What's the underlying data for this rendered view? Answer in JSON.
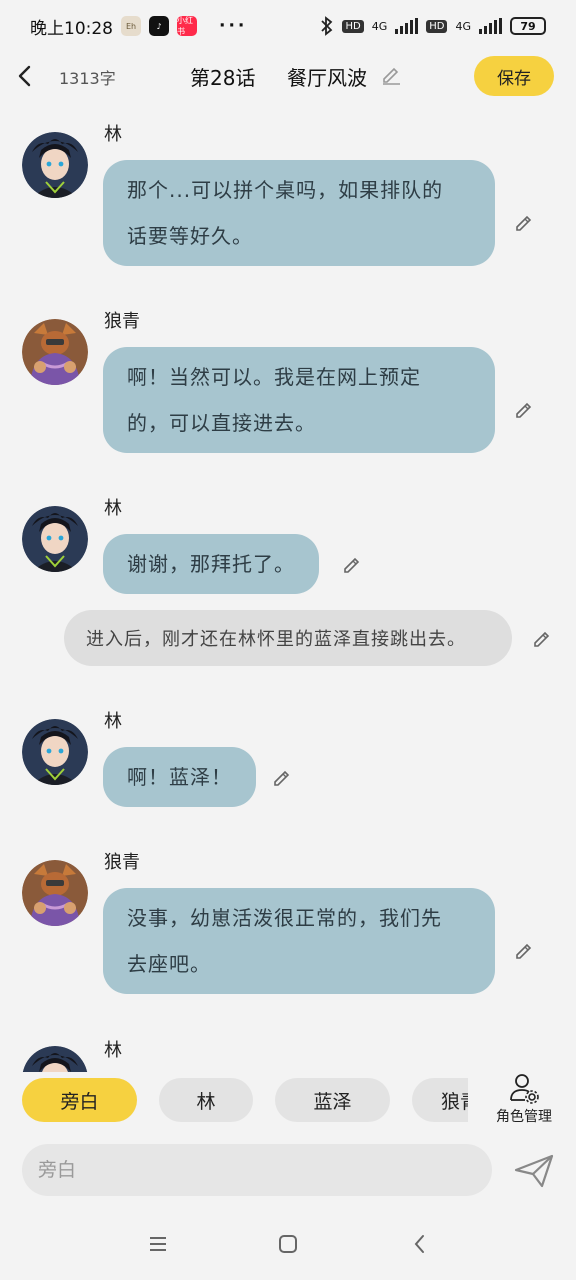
{
  "status_bar": {
    "time": "晚上10:28",
    "apps": [
      "Eh",
      "抖音",
      "小红书"
    ],
    "more": "···",
    "hd1": "HD",
    "net1": "4G",
    "hd2": "HD",
    "net2": "4G",
    "battery": "79"
  },
  "header": {
    "word_count": "1313字",
    "chapter": "第28话",
    "chapter_name": "餐厅风波",
    "save_label": "保存"
  },
  "colors": {
    "accent": "#f6d140",
    "bubble": "#a7c5cf",
    "narration": "#dedede",
    "background": "#f3f3f3"
  },
  "messages": [
    {
      "type": "dialogue",
      "speaker": "林",
      "avatar": "lin-avatar",
      "lines": [
        "那个...可以拼个桌吗，如果排队的",
        "话要等好久。"
      ]
    },
    {
      "type": "dialogue",
      "speaker": "狼青",
      "avatar": "langqing-avatar",
      "lines": [
        "啊！当然可以。我是在网上预定",
        "的，可以直接进去。"
      ]
    },
    {
      "type": "dialogue",
      "speaker": "林",
      "avatar": "lin-avatar",
      "lines": [
        "谢谢，那拜托了。"
      ]
    },
    {
      "type": "narration",
      "text": "进入后，刚才还在林怀里的蓝泽直接跳出去。"
    },
    {
      "type": "dialogue",
      "speaker": "林",
      "avatar": "lin-avatar",
      "lines": [
        "啊！蓝泽！"
      ]
    },
    {
      "type": "dialogue",
      "speaker": "狼青",
      "avatar": "langqing-avatar",
      "lines": [
        "没事，幼崽活泼很正常的，我们先",
        "去座吧。"
      ]
    },
    {
      "type": "dialogue",
      "speaker": "林",
      "avatar": "lin-avatar",
      "lines": []
    }
  ],
  "roles": {
    "chips": [
      "旁白",
      "林",
      "蓝泽",
      "狼青"
    ],
    "selected": "旁白",
    "manage_label": "角色管理"
  },
  "input": {
    "placeholder": "旁白",
    "value": ""
  }
}
